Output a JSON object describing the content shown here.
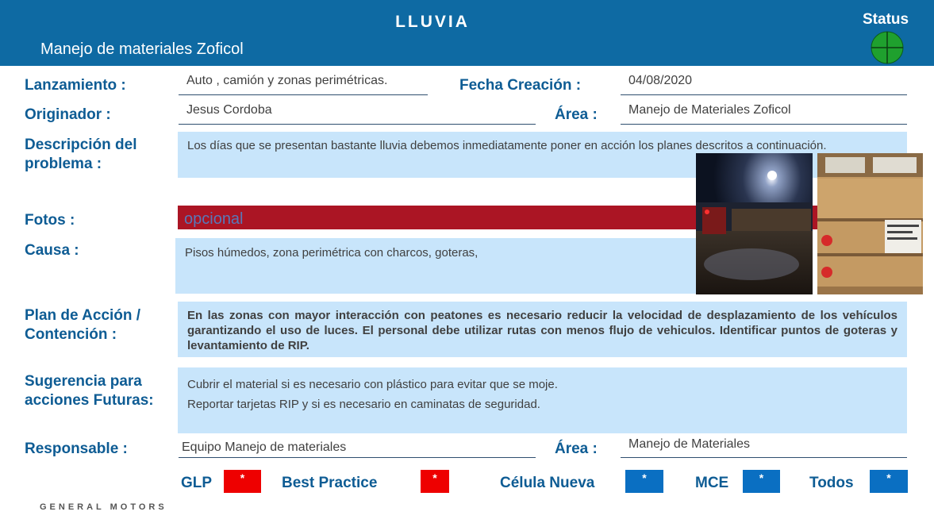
{
  "header": {
    "title": "LLUVIA",
    "subtitle": "Manejo de materiales Zoficol",
    "status_label": "Status",
    "status_color": "#1fa02e"
  },
  "lanzamiento": {
    "label": "Lanzamiento :",
    "value": "Auto , camión y zonas perimétricas."
  },
  "fecha_creacion": {
    "label": "Fecha Creación :",
    "value": "04/08/2020"
  },
  "originador": {
    "label": "Originador :",
    "value": "Jesus Cordoba"
  },
  "area_top": {
    "label": "Área :",
    "value": "Manejo de Materiales Zoficol"
  },
  "descripcion": {
    "label_line1": "Descripción del",
    "label_line2": "problema :",
    "value": "Los días que se presentan bastante lluvia debemos inmediatamente poner en acción los planes descritos a continuación."
  },
  "fotos": {
    "label": "Fotos :",
    "value": "opcional"
  },
  "causa": {
    "label": "Causa :",
    "value": "Pisos húmedos, zona perimétrica con charcos, goteras,"
  },
  "plan_accion": {
    "label_line1": "Plan de Acción /",
    "label_line2": "Contención :",
    "value": "En las zonas con mayor interacción con peatones es necesario reducir la velocidad de desplazamiento de los vehículos garantizando el uso de luces. El personal debe utilizar rutas con menos flujo de vehiculos. Identificar puntos de goteras y levantamiento de RIP."
  },
  "sugerencia": {
    "label_line1": "Sugerencia para",
    "label_line2": "acciones  Futuras:",
    "line1": "Cubrir el material si es necesario con plástico para evitar que se moje.",
    "line2": "Reportar tarjetas RIP y si es necesario en caminatas de seguridad."
  },
  "responsable": {
    "label": "Responsable :",
    "value": "Equipo Manejo de materiales"
  },
  "area_bottom": {
    "label": "Área :",
    "value": "Manejo de Materiales"
  },
  "flags": [
    {
      "label": "GLP",
      "mark": "*",
      "color": "#ee0000"
    },
    {
      "label": "Best Practice",
      "mark": "*",
      "color": "#ee0000"
    },
    {
      "label": "Célula Nueva",
      "mark": "*",
      "color": "#0a6fc2"
    },
    {
      "label": "MCE",
      "mark": "*",
      "color": "#0a6fc2"
    },
    {
      "label": "Todos",
      "mark": "*",
      "color": "#0a6fc2"
    }
  ],
  "footer": {
    "brand": "GENERAL MOTORS"
  }
}
